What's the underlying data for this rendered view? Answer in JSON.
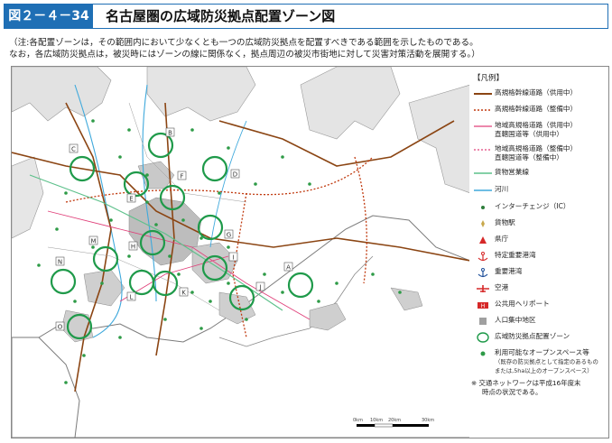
{
  "header": {
    "figure_number": "図２－４－34",
    "title": "名古屋圏の広域防災拠点配置ゾーン図"
  },
  "notes": [
    "（注:各配置ゾーンは，その範囲内において少なくとも一つの広域防災拠点を配置すべきである範囲を示したものである。",
    "なお，各広域防災拠点は，被災時にはゾーンの線に関係なく，拠点周辺の被災市街地に対して災害対策活動を展開する。）"
  ],
  "map": {
    "zone_labels": [
      "A",
      "B",
      "C",
      "D",
      "E",
      "F",
      "G",
      "H",
      "I",
      "J",
      "K",
      "L",
      "M",
      "N",
      "O"
    ],
    "scale_labels": [
      "0km",
      "10km",
      "20km",
      "30km"
    ],
    "colors": {
      "zone_circle": "#1f9a4a",
      "expressway_built": "#8b4513",
      "expressway_planned": "#c0390e",
      "regional_road_built": "#e0407a",
      "freight_line": "#5cc08a",
      "river": "#3fa9dc",
      "populated_area": "#c8c8c8",
      "open_space": "#2e9b47"
    }
  },
  "legend": {
    "title": "【凡例】",
    "items": [
      {
        "label": "高規格幹線道路（供用中）"
      },
      {
        "label": "高規格幹線道路（整備中）"
      },
      {
        "label": "地域高規格道路（供用中）",
        "sub": "直轄国道等（供用中）"
      },
      {
        "label": "地域高規格道路（整備中）",
        "sub": "直轄国道等（整備中）"
      },
      {
        "label": "貨物営業線"
      },
      {
        "label": "河川"
      },
      {
        "label": "インターチェンジ（IC）"
      },
      {
        "label": "貨物駅"
      },
      {
        "label": "県庁"
      },
      {
        "label": "特定重要港湾"
      },
      {
        "label": "重要港湾"
      },
      {
        "label": "空港"
      },
      {
        "label": "公共用ヘリポート"
      },
      {
        "label": "人口集中地区"
      },
      {
        "label": "広域防災拠点配置ゾーン"
      },
      {
        "label": "利用可能なオープンスペース等",
        "sub": "（既存の防災拠点として指定のあるもの",
        "sub2": "または,5ha以上のオープンスペース）"
      }
    ],
    "footnote": [
      "※ 交通ネットワークは平成16年度末",
      "時点の状況である。"
    ]
  }
}
